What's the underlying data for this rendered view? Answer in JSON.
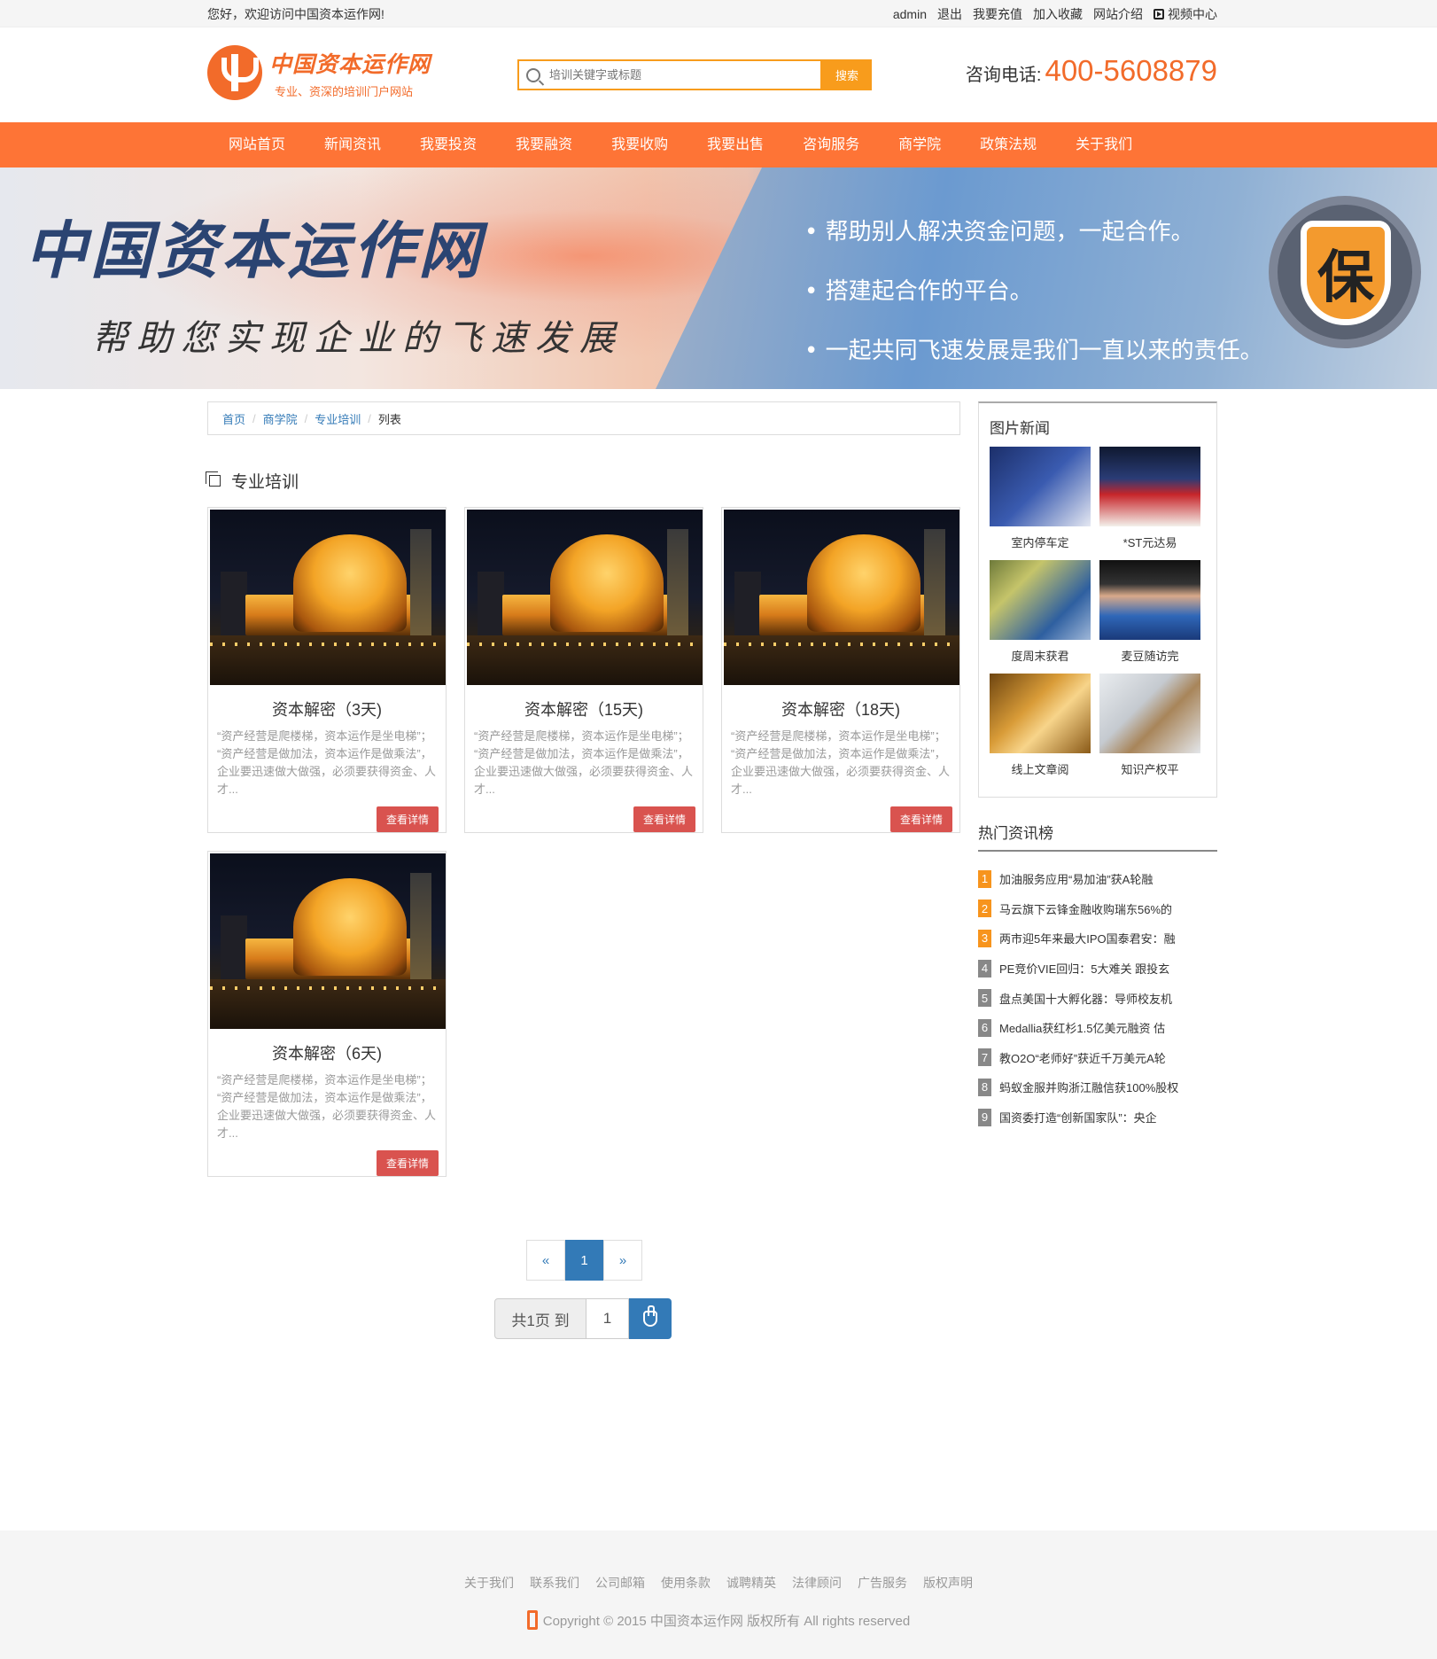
{
  "topbar": {
    "welcome": "您好，欢迎访问中国资本运作网!",
    "links": [
      "admin",
      "退出",
      "我要充值",
      "加入收藏",
      "网站介绍"
    ],
    "video": "视频中心"
  },
  "header": {
    "logo_title": "中国资本运作网",
    "logo_sub": "专业、资深的培训门户网站",
    "search_placeholder": "培训关键字或标题",
    "search_button": "搜索",
    "phone_label": "咨询电话:",
    "phone_number": "400-5608879"
  },
  "nav": [
    "网站首页",
    "新闻资讯",
    "我要投资",
    "我要融资",
    "我要收购",
    "我要出售",
    "咨询服务",
    "商学院",
    "政策法规",
    "关于我们"
  ],
  "banner": {
    "title": "中国资本运作网",
    "subtitle": "帮助您实现企业的飞速发展",
    "points": [
      "• 帮助别人解决资金问题，一起合作。",
      "• 搭建起合作的平台。",
      "• 一起共同飞速发展是我们一直以来的责任。"
    ],
    "badge": "保"
  },
  "breadcrumb": {
    "links": [
      "首页",
      "商学院",
      "专业培训"
    ],
    "current": "列表",
    "sep": "/"
  },
  "section_title": "专业培训",
  "cards": [
    {
      "title": "资本解密（3天)",
      "desc": "“资产经营是爬楼梯，资本运作是坐电梯”； “资产经营是做加法，资本运作是做乘法”，企业要迅速做大做强，必须要获得资金、人才...",
      "button": "查看详情"
    },
    {
      "title": "资本解密（15天)",
      "desc": "“资产经营是爬楼梯，资本运作是坐电梯”； “资产经营是做加法，资本运作是做乘法”，企业要迅速做大做强，必须要获得资金、人才...",
      "button": "查看详情"
    },
    {
      "title": "资本解密（18天)",
      "desc": "“资产经营是爬楼梯，资本运作是坐电梯”； “资产经营是做加法，资本运作是做乘法”，企业要迅速做大做强，必须要获得资金、人才...",
      "button": "查看详情"
    },
    {
      "title": "资本解密（6天)",
      "desc": "“资产经营是爬楼梯，资本运作是坐电梯”； “资产经营是做加法，资本运作是做乘法”，企业要迅速做大做强，必须要获得资金、人才...",
      "button": "查看详情"
    }
  ],
  "pager": {
    "prev": "«",
    "current": "1",
    "next": "»",
    "jump_label": "共1页 到",
    "jump_value": "1"
  },
  "pic_news": {
    "title": "图片新闻",
    "items": [
      "室内停车定",
      "*ST元达易",
      "度周末获君",
      "麦豆随访完",
      "线上文章阅",
      "知识产权平"
    ]
  },
  "hot_news": {
    "title": "热门资讯榜",
    "items": [
      "加油服务应用“易加油”获A轮融",
      "马云旗下云锋金融收购瑞东56%的",
      "两市迎5年来最大IPO国泰君安：融",
      "PE竞价VIE回归：5大难关 跟投玄",
      "盘点美国十大孵化器：导师校友机",
      "Medallia获红杉1.5亿美元融资 估",
      "教O2O“老师好”获近千万美元A轮",
      "蚂蚁金服并购浙江融信获100%股权",
      "国资委打造“创新国家队”：央企"
    ]
  },
  "footer": {
    "links": [
      "关于我们",
      "联系我们",
      "公司邮箱",
      "使用条款",
      "诚聘精英",
      "法律顾问",
      "广告服务",
      "版权声明"
    ],
    "copyright": "Copyright © 2015 中国资本运作网 版权所有 All rights reserved"
  }
}
